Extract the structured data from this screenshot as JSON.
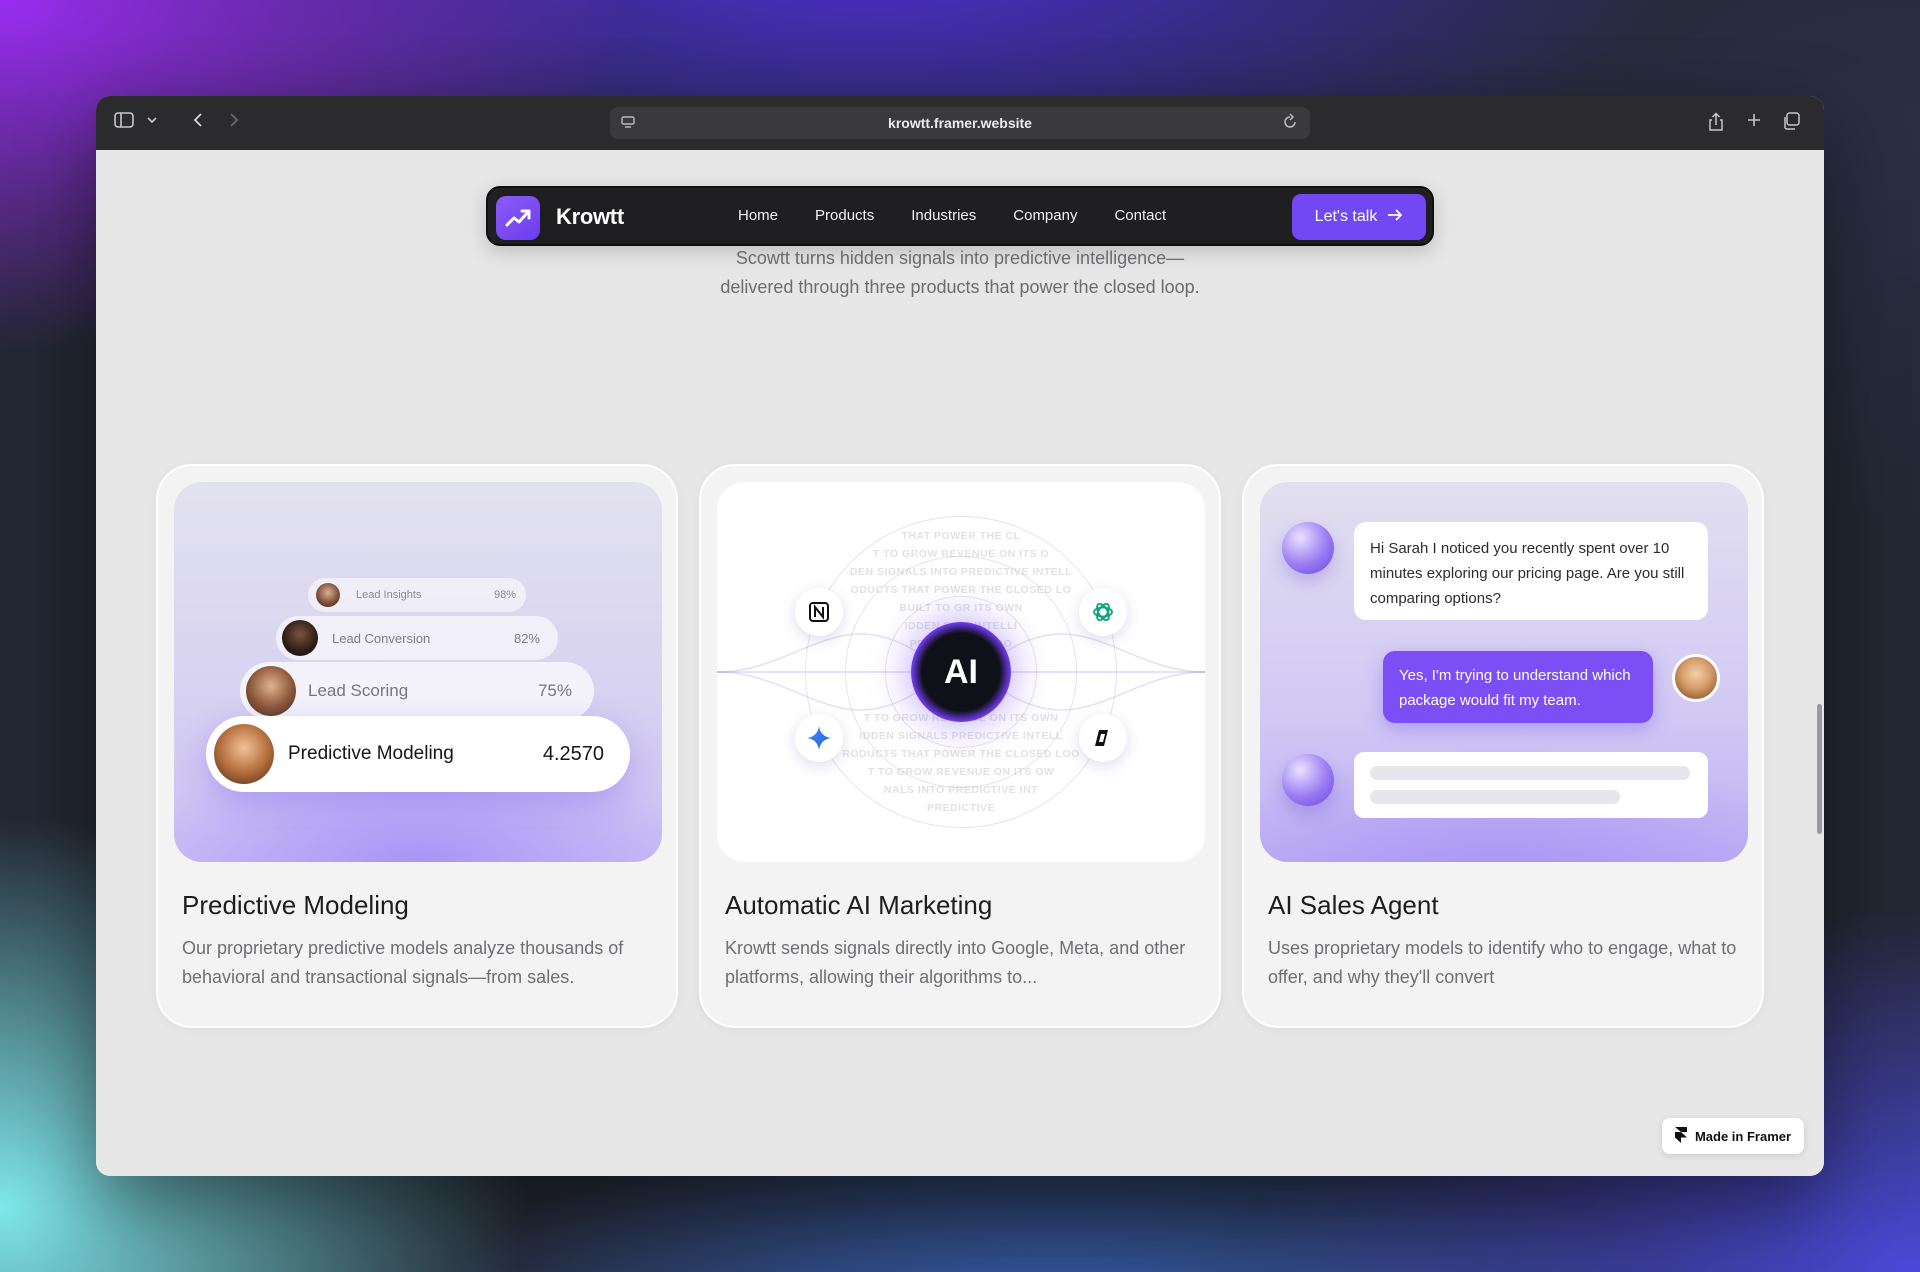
{
  "browser": {
    "url": "krowtt.framer.website",
    "icons": [
      "sidebar-icon",
      "chevron-down-icon",
      "back-icon",
      "forward-icon",
      "site-settings-icon",
      "reload-icon",
      "share-icon",
      "new-tab-icon",
      "tabs-overview-icon"
    ]
  },
  "navbar": {
    "brand": "Krowtt",
    "links": [
      "Home",
      "Products",
      "Industries",
      "Company",
      "Contact"
    ],
    "cta_label": "Let's talk",
    "accent": "#7248f5"
  },
  "intro": {
    "line1": "Scowtt turns hidden signals into predictive intelligence—",
    "line2": "delivered through three products that power the closed loop."
  },
  "cards": [
    {
      "title": "Predictive Modeling",
      "desc": "Our proprietary predictive models analyze thousands of behavioral and transactional signals—from sales.",
      "pills": [
        {
          "label": "Lead Insights",
          "value": "98%"
        },
        {
          "label": "Lead Conversion",
          "value": "82%"
        },
        {
          "label": "Lead Scoring",
          "value": "75%"
        },
        {
          "label": "Predictive Modeling",
          "value": "4.2570"
        }
      ]
    },
    {
      "title": "Automatic AI Marketing",
      "desc": "Krowtt sends signals directly into Google, Meta, and other platforms, allowing their algorithms to...",
      "core_label": "AI",
      "background_text": [
        "THAT POWER THE CL",
        "T TO GROW REVENUE ON ITS O",
        "DEN SIGNALS INTO PREDICTIVE INTELL",
        "ODUCTS THAT POWER THE CLOSED LO",
        "BUILT TO GR  ITS OWN",
        "IDDEN SIGN  INTELLI",
        "PRODUC  SED LOO",
        "HIDDEN  INTELLI",
        "BUILT  WN",
        "IDDEN SIGNALS  PREDICTIVE INTELL",
        "RODUCTS THAT POWER THE CLOSED LOO",
        "T TO GROW REVENUE ON ITS OW",
        "NALS INTO PREDICTIVE INT",
        "T TO GROW REVENUE ON ITS OWN",
        "HE CLOSED",
        "PREDICTIVE"
      ]
    },
    {
      "title": "AI Sales Agent",
      "desc": "Uses proprietary models to identify who to engage, what to offer, and why they'll convert",
      "chat_in": "Hi Sarah I noticed you recently spent over 10 minutes exploring our pricing page. Are you still comparing options?",
      "chat_out": "Yes, I'm trying to understand which package would fit my team."
    }
  ],
  "badge": "Made in Framer"
}
